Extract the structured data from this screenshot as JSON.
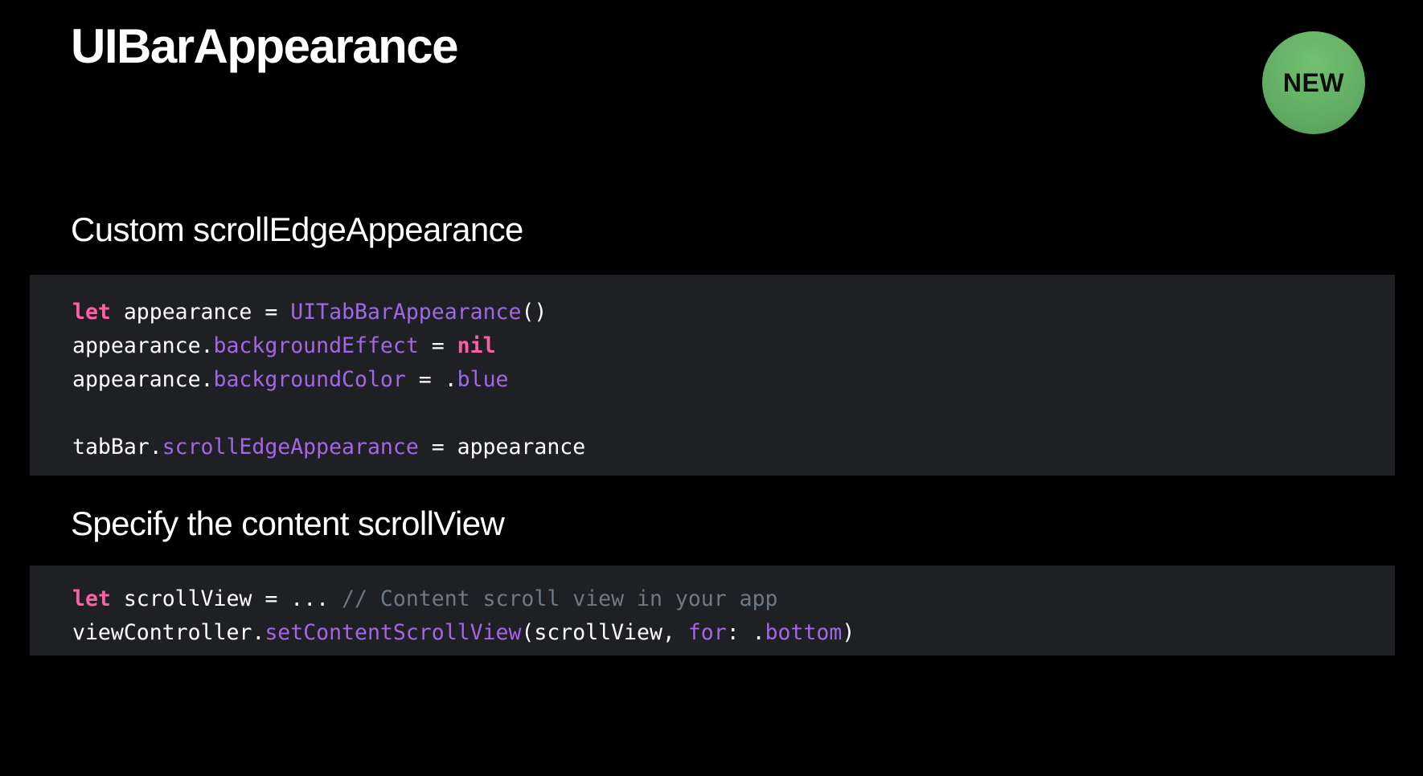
{
  "slide": {
    "title": "UIBarAppearance",
    "badge": "NEW"
  },
  "colors": {
    "background": "#000000",
    "code_background": "#1f2023",
    "keyword": "#fc5fa3",
    "identifier": "#a167e6",
    "comment": "#6c7986",
    "badge": "#62ad63"
  },
  "sections": [
    {
      "heading": "Custom scrollEdgeAppearance",
      "code_lines": [
        [
          {
            "text": "let",
            "kind": "keyword"
          },
          {
            "text": " appearance = ",
            "kind": "plain"
          },
          {
            "text": "UITabBarAppearance",
            "kind": "identifier"
          },
          {
            "text": "()",
            "kind": "plain"
          }
        ],
        [
          {
            "text": "appearance.",
            "kind": "plain"
          },
          {
            "text": "backgroundEffect",
            "kind": "identifier"
          },
          {
            "text": " = ",
            "kind": "plain"
          },
          {
            "text": "nil",
            "kind": "keyword"
          }
        ],
        [
          {
            "text": "appearance.",
            "kind": "plain"
          },
          {
            "text": "backgroundColor",
            "kind": "identifier"
          },
          {
            "text": " = .",
            "kind": "plain"
          },
          {
            "text": "blue",
            "kind": "identifier"
          }
        ],
        [],
        [
          {
            "text": "tabBar.",
            "kind": "plain"
          },
          {
            "text": "scrollEdgeAppearance",
            "kind": "identifier"
          },
          {
            "text": " = appearance",
            "kind": "plain"
          }
        ]
      ]
    },
    {
      "heading": "Specify the content scrollView",
      "code_lines": [
        [
          {
            "text": "let",
            "kind": "keyword"
          },
          {
            "text": " scrollView = ... ",
            "kind": "plain"
          },
          {
            "text": "// Content scroll view in your app",
            "kind": "comment"
          }
        ],
        [
          {
            "text": "viewController.",
            "kind": "plain"
          },
          {
            "text": "setContentScrollView",
            "kind": "identifier"
          },
          {
            "text": "(scrollView, ",
            "kind": "plain"
          },
          {
            "text": "for",
            "kind": "identifier"
          },
          {
            "text": ": .",
            "kind": "plain"
          },
          {
            "text": "bottom",
            "kind": "identifier"
          },
          {
            "text": ")",
            "kind": "plain"
          }
        ]
      ]
    }
  ]
}
